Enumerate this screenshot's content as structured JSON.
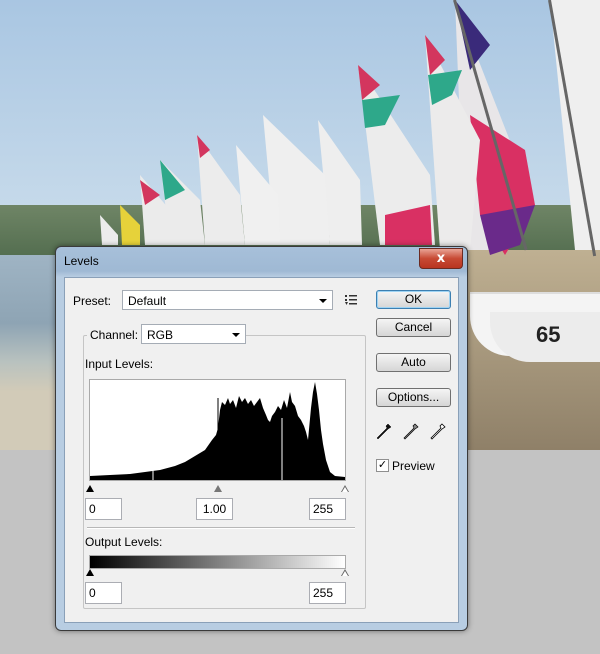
{
  "background": {
    "boat_number": "65"
  },
  "dialog": {
    "title": "Levels",
    "close_glyph": "x",
    "preset_label": "Preset:",
    "preset_value": "Default",
    "preset_menu_icon": "list-menu-icon",
    "channel_label": "Channel:",
    "channel_value": "RGB",
    "input_levels_label": "Input Levels:",
    "input_black": "0",
    "input_gamma": "1.00",
    "input_white": "255",
    "output_levels_label": "Output Levels:",
    "output_black": "0",
    "output_white": "255",
    "buttons": {
      "ok": "OK",
      "cancel": "Cancel",
      "auto": "Auto",
      "options": "Options..."
    },
    "eyedroppers": [
      "black-point-eyedropper-icon",
      "gray-point-eyedropper-icon",
      "white-point-eyedropper-icon"
    ],
    "preview_label": "Preview",
    "preview_checked": "✓"
  },
  "colors": {
    "accent_close": "#c74a34",
    "default_button_border": "#3c7fb1"
  }
}
